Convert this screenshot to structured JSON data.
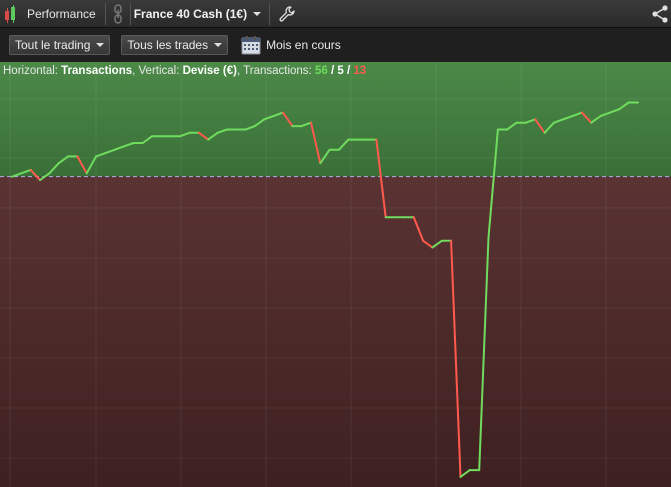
{
  "header": {
    "app_title": "Performance",
    "instrument": "France 40 Cash (1€)"
  },
  "toolbar": {
    "trading_filter": "Tout le trading",
    "trades_filter": "Tous les trades",
    "period": "Mois en cours"
  },
  "info": {
    "h_label": "Horizontal: ",
    "h_value": "Transactions",
    "v_label": ", Vertical: ",
    "v_value": "Devise (€)",
    "t_label": ", Transactions: ",
    "count_gain": "56",
    "sep1": " / ",
    "count_neutral": "5",
    "sep2": " / ",
    "count_loss": "13"
  },
  "colors": {
    "gain": "#6fdc5e",
    "loss": "#ff5a4d",
    "positive_zone": "#3f7a3d",
    "negative_zone": "#4e2a2a",
    "zero_line": "#b9a8e8"
  },
  "chart_data": {
    "type": "line",
    "x": [
      1,
      2,
      3,
      4,
      5,
      6,
      7,
      8,
      9,
      10,
      11,
      12,
      13,
      14,
      15,
      16,
      17,
      18,
      19,
      20,
      21,
      22,
      23,
      24,
      25,
      26,
      27,
      28,
      29,
      30,
      31,
      32,
      33,
      34,
      35,
      36,
      37,
      38,
      39,
      40,
      41,
      42,
      43,
      44,
      45,
      46,
      47,
      48,
      49,
      50,
      51,
      52,
      53,
      54,
      55,
      56,
      57,
      58,
      59,
      60,
      61,
      62,
      63,
      64,
      65,
      66,
      67,
      68,
      69,
      70,
      71,
      72,
      73,
      74
    ],
    "values": [
      0,
      1,
      2,
      -1,
      1,
      4,
      6,
      6,
      1,
      6,
      7,
      8,
      9,
      10,
      10,
      12,
      12,
      12,
      12,
      13,
      13,
      11,
      13,
      14,
      14,
      14,
      15,
      17,
      18,
      19,
      15,
      15,
      16,
      4,
      8,
      8,
      11,
      11,
      11,
      11,
      -12,
      -12,
      -12,
      -12,
      -19,
      -21,
      -19,
      -19,
      -89,
      -87,
      -87,
      -18,
      14,
      14,
      16,
      16,
      17,
      13,
      16,
      17,
      18,
      19,
      16,
      18,
      19,
      20,
      22,
      22
    ],
    "segment_color": "rising segments green, falling segments red",
    "ylim": [
      -92,
      34
    ]
  }
}
